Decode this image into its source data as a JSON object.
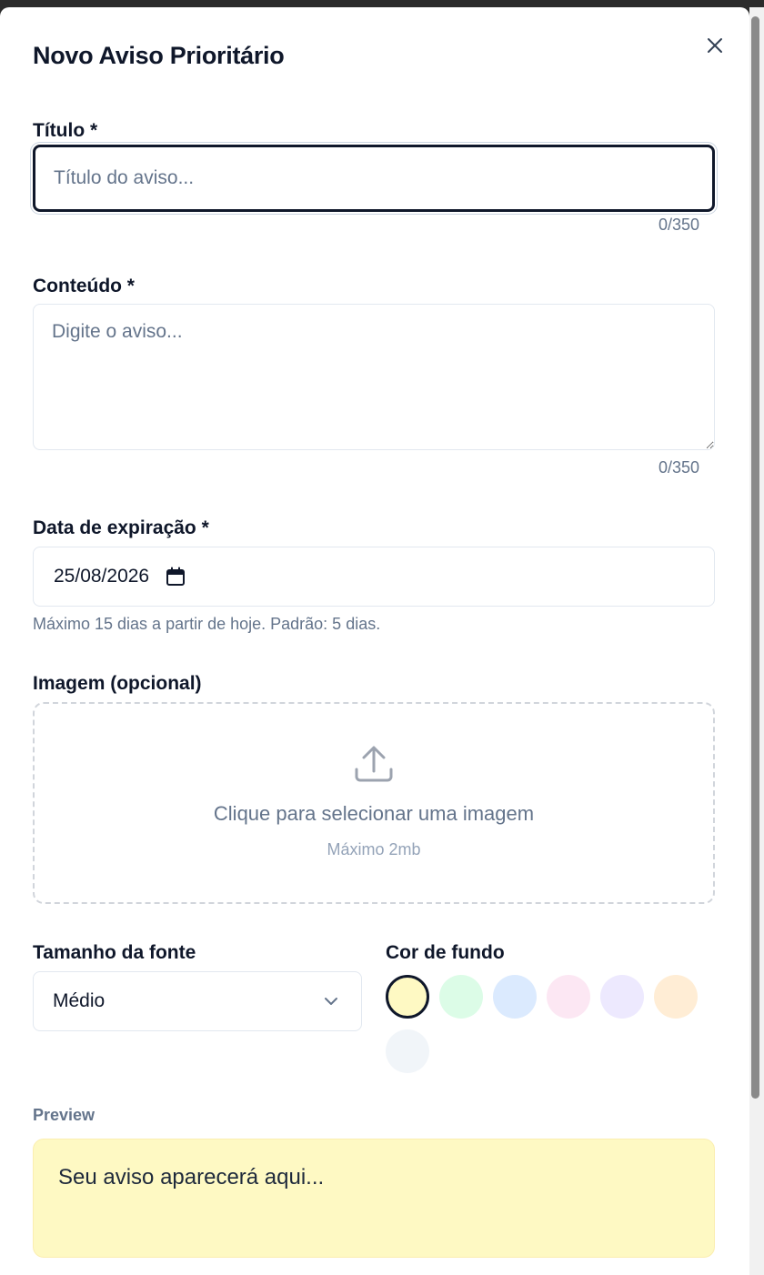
{
  "modal": {
    "title": "Novo Aviso Prioritário"
  },
  "titulo": {
    "label": "Título *",
    "placeholder": "Título do aviso...",
    "counter": "0/350"
  },
  "conteudo": {
    "label": "Conteúdo *",
    "placeholder": "Digite o aviso...",
    "counter": "0/350"
  },
  "expiracao": {
    "label": "Data de expiração *",
    "value": "25/08/2026",
    "hint": "Máximo 15 dias a partir de hoje. Padrão: 5 dias."
  },
  "imagem": {
    "label": "Imagem (opcional)",
    "upload_text": "Clique para selecionar uma imagem",
    "max_size": "Máximo 2mb",
    "icon": "upload-icon"
  },
  "fonte": {
    "label": "Tamanho da fonte",
    "selected": "Médio"
  },
  "cor_fundo": {
    "label": "Cor de fundo",
    "selected_index": 0,
    "swatches": [
      "#fef9c3",
      "#dcfce7",
      "#dbeafe",
      "#fce7f3",
      "#ede9fe",
      "#ffedd5",
      "#f1f5f9"
    ]
  },
  "preview": {
    "label": "Preview",
    "text": "Seu aviso aparecerá aqui...",
    "background": "#fef9c3"
  }
}
